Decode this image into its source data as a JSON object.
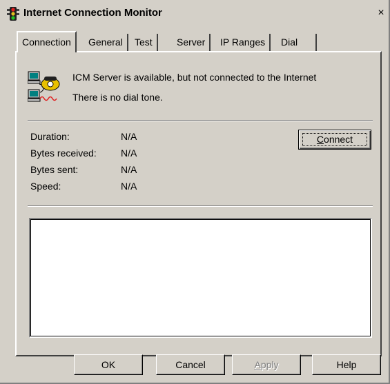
{
  "window": {
    "title": "Internet Connection Monitor",
    "close_label": "×"
  },
  "tabs": [
    {
      "label": "Connection",
      "active": true
    },
    {
      "label": "General",
      "active": false
    },
    {
      "label": "Test",
      "active": false
    },
    {
      "label": "Server",
      "active": false
    },
    {
      "label": "IP Ranges",
      "active": false
    },
    {
      "label": "Dial",
      "active": false
    }
  ],
  "status": {
    "icon": "network-phone-icon",
    "server_message": "ICM Server is available, but not connected to the Internet",
    "dial_message": "There is no dial tone."
  },
  "stats": [
    {
      "label": "Duration:",
      "value": "N/A"
    },
    {
      "label": "Bytes received:",
      "value": "N/A"
    },
    {
      "label": "Bytes sent:",
      "value": "N/A"
    },
    {
      "label": "Speed:",
      "value": "N/A"
    }
  ],
  "connect_button": {
    "accel": "C",
    "rest": "onnect"
  },
  "log": {
    "content": ""
  },
  "buttons": {
    "ok": "OK",
    "cancel": "Cancel",
    "apply_accel": "A",
    "apply_rest": "pply",
    "help": "Help"
  },
  "colors": {
    "dialog_face": "#d4d0c8",
    "shadow": "#808080",
    "highlight": "#ffffff",
    "disabled_text": "#808080"
  }
}
